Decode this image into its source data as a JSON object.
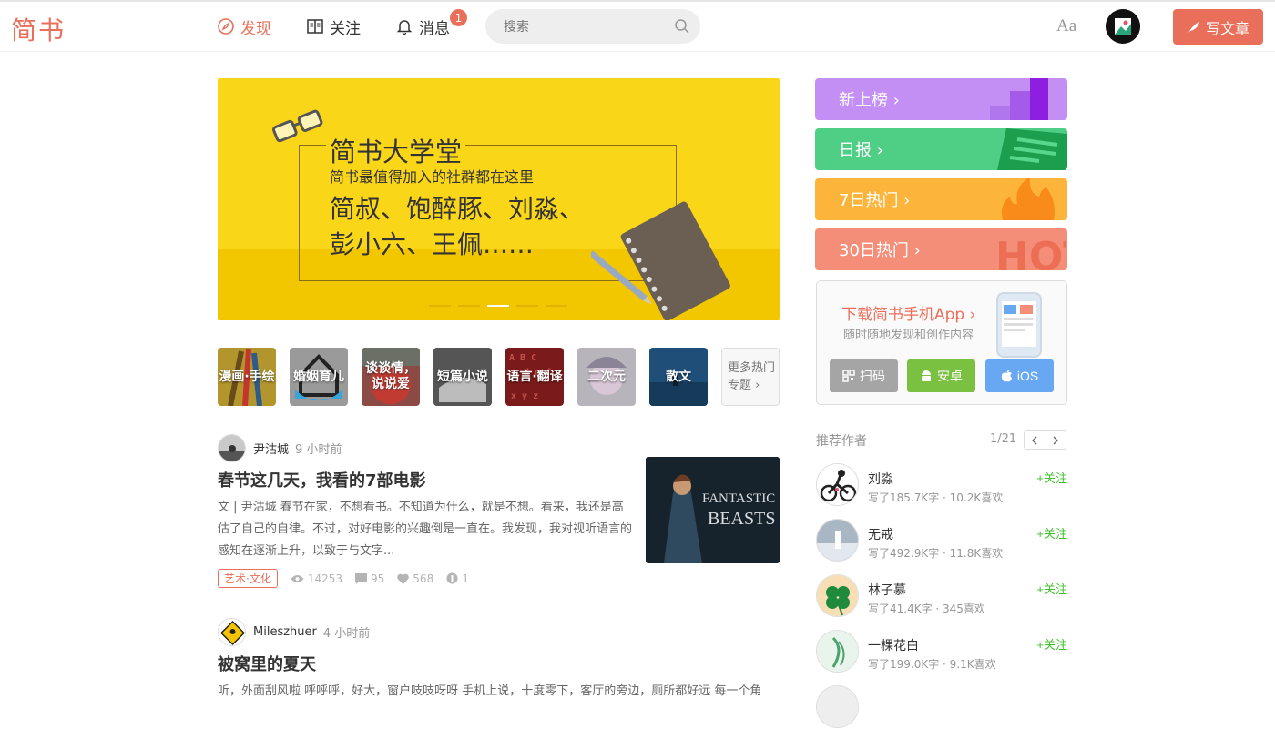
{
  "colors": {
    "brand": "#ea6f5a",
    "follow": "#42c02e"
  },
  "header": {
    "logo": "简书",
    "nav": [
      {
        "label": "发现",
        "icon": "compass-icon"
      },
      {
        "label": "关注",
        "icon": "book-icon"
      },
      {
        "label": "消息",
        "icon": "bell-icon"
      }
    ],
    "message_badge": "1",
    "search_placeholder": "搜索",
    "font_toggle": "Aa",
    "write_label": "写文章"
  },
  "banner": {
    "title": "简书大学堂",
    "subtitle": "简书最值得加入的社群都在这里",
    "names_line1": "简叔、饱醉豚、刘淼、",
    "names_line2": "彭小六、王佩……",
    "slides": 5,
    "active_slide": 3
  },
  "topics": [
    {
      "label": "漫画·手绘",
      "color": "#b2962d"
    },
    {
      "label": "婚姻育儿",
      "color": "#9a9a9a"
    },
    {
      "label": "谈谈情，说说爱",
      "color": "#8c4a45"
    },
    {
      "label": "短篇小说",
      "color": "#4a4a4a"
    },
    {
      "label": "语言·翻译",
      "color": "#7b1a1a"
    },
    {
      "label": "二次元",
      "color": "#b8b4bc"
    },
    {
      "label": "散文",
      "color": "#1f4e79"
    }
  ],
  "topics_more": {
    "line1": "更多热门",
    "line2": "专题 ›"
  },
  "articles": [
    {
      "author": "尹沽城",
      "time": "9 小时前",
      "title": "春节这几天，我看的7部电影",
      "abstract": "文 | 尹沽城 春节在家，不想看书。不知道为什么，就是不想。看来，我还是高估了自己的自律。不过，对好电影的兴趣倒是一直在。我发现，我对视听语言的感知在逐渐上升，以致于与文字...",
      "tag": "艺术·文化",
      "views": "14253",
      "comments": "95",
      "likes": "568",
      "rewards": "1",
      "thumb_text1": "FANTASTIC",
      "thumb_text2": "BEASTS"
    },
    {
      "author": "Mileszhuer",
      "time": "4 小时前",
      "title": "被窝里的夏天",
      "abstract": "听，外面刮风啦 呼呼呼，好大，窗户吱吱呀呀 手机上说，十度零下，客厅的旁边，厕所都好远 每一个角"
    }
  ],
  "boards": [
    {
      "label": "新上榜 ›"
    },
    {
      "label": "日报 ›"
    },
    {
      "label": "7日热门 ›"
    },
    {
      "label": "30日热门 ›",
      "deco": "HOT"
    }
  ],
  "app": {
    "title": "下载简书手机App ›",
    "subtitle": "随时随地发现和创作内容",
    "buttons": [
      {
        "label": "扫码",
        "icon": "qrcode-icon"
      },
      {
        "label": "安卓",
        "icon": "android-icon"
      },
      {
        "label": "iOS",
        "icon": "apple-icon"
      }
    ]
  },
  "recommend": {
    "heading": "推荐作者",
    "page": "1/21",
    "follow_label": "+关注",
    "authors": [
      {
        "name": "刘淼",
        "stats": "写了185.7K字 · 10.2K喜欢"
      },
      {
        "name": "无戒",
        "stats": "写了492.9K字 · 11.8K喜欢"
      },
      {
        "name": "林子慕",
        "stats": "写了41.4K字 · 345喜欢"
      },
      {
        "name": "一棵花白",
        "stats": "写了199.0K字 · 9.1K喜欢"
      }
    ]
  }
}
